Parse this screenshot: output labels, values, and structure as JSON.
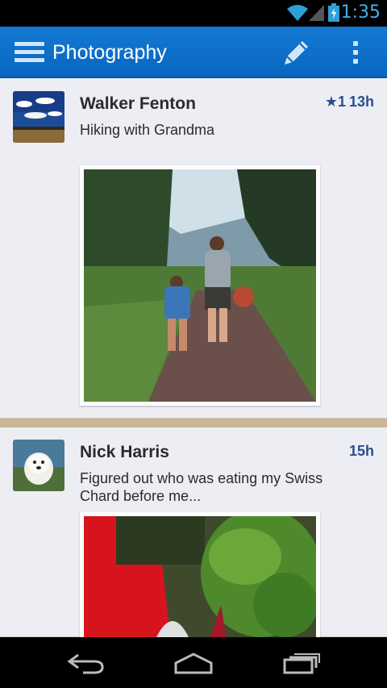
{
  "status_bar": {
    "time": "1:35"
  },
  "action_bar": {
    "title": "Photography"
  },
  "posts": [
    {
      "author": "Walker Fenton",
      "stars": "★1",
      "age": "13h",
      "text": "Hiking with Grandma"
    },
    {
      "author": "Nick Harris",
      "age": "15h",
      "text": "Figured out who was eating my Swiss Chard before me..."
    }
  ],
  "icons": {
    "menu": "menu-icon",
    "compose": "pencil-icon",
    "overflow": "overflow-icon",
    "back": "back-icon",
    "home": "home-icon",
    "recents": "recents-icon",
    "wifi": "wifi-icon",
    "signal": "signal-icon",
    "battery": "battery-icon"
  },
  "colors": {
    "accent": "#0a6fcb",
    "meta": "#2a4f8c",
    "status_clock": "#3fb1e8"
  }
}
